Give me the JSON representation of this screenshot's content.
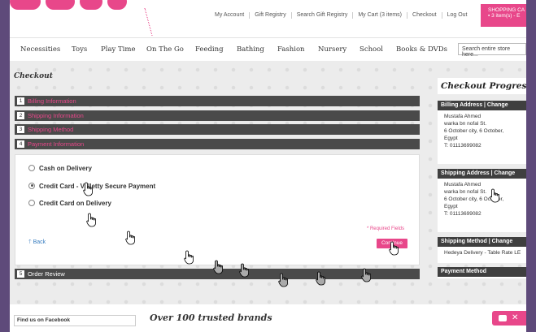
{
  "header": {
    "top_links": [
      "My Account",
      "Gift Registry",
      "Search Gift Registry",
      "My Cart (3 items)",
      "Checkout",
      "Log Out"
    ],
    "cart": {
      "title": "SHOPPING CA",
      "summary": "3 item(s) - E"
    }
  },
  "nav": {
    "items": [
      "Necessities",
      "Toys",
      "Play Time",
      "On The Go",
      "Feeding",
      "Bathing",
      "Fashion",
      "Nursery",
      "School",
      "Books & DVDs"
    ],
    "search_placeholder": "Search entire store here..."
  },
  "checkout": {
    "title": "Checkout",
    "steps": [
      {
        "num": "1",
        "label": "Billing Information"
      },
      {
        "num": "2",
        "label": "Shipping Information"
      },
      {
        "num": "3",
        "label": "Shipping Method"
      },
      {
        "num": "4",
        "label": "Payment Information"
      },
      {
        "num": "5",
        "label": "Order Review"
      }
    ],
    "payment_options": [
      "Cash on Delivery",
      "Credit Card - Valletty Secure Payment",
      "Credit Card on Delivery"
    ],
    "selected_option": "Credit Card - Valletty Secure Payment",
    "required_note": "* Required Fields",
    "back_label": "Back",
    "continue_label": "Continue"
  },
  "progress": {
    "title": "Checkout Progress",
    "billing": {
      "header": "Billing Address | Change",
      "lines": [
        "Mustafa Ahmed",
        "warka bn nofal St.",
        "6 October city, 6 October,",
        "Egypt",
        "T: 01113699082"
      ]
    },
    "shipping": {
      "header": "Shipping Address | Change",
      "lines": [
        "Mustafa Ahmed",
        "warka bn nofal St.",
        "6 October city, 6 October,",
        "Egypt",
        "T: 01113699082"
      ]
    },
    "method": {
      "header": "Shipping Method | Change",
      "lines": [
        "Hedeya Delivery - Table Rate LE"
      ]
    },
    "payment": {
      "header": "Payment Method"
    }
  },
  "footer": {
    "facebook_label": "Find us on Facebook",
    "brands_heading": "Over 100 trusted brands"
  },
  "colors": {
    "accent": "#e8478a",
    "dark_bar": "#4a4a4a",
    "link": "#3a7ec0"
  }
}
